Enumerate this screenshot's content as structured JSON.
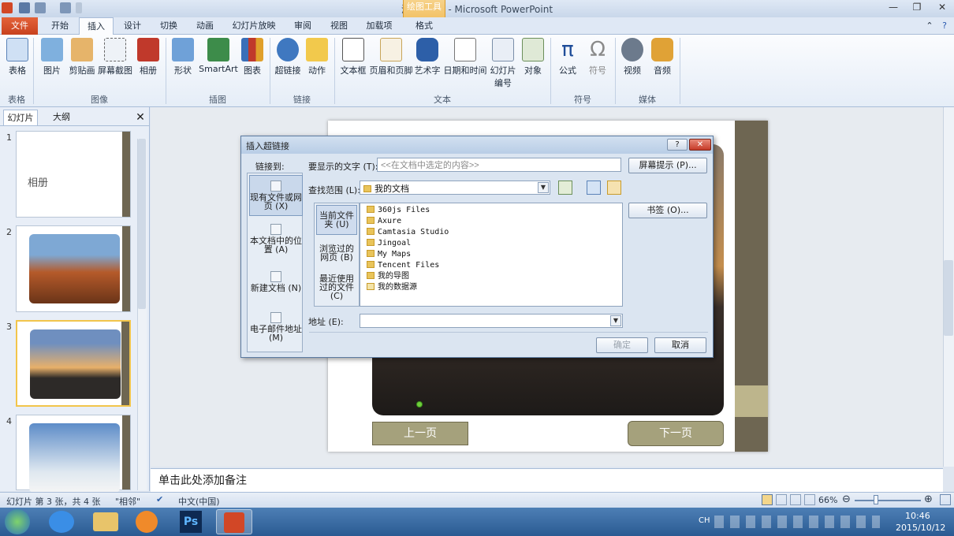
{
  "window": {
    "title": "演示文稿2 - Microsoft PowerPoint",
    "context_tab_group": "绘图工具"
  },
  "tabs": [
    "文件",
    "开始",
    "插入",
    "设计",
    "切换",
    "动画",
    "幻灯片放映",
    "审阅",
    "视图",
    "加载项",
    "格式"
  ],
  "ribbon": {
    "buttons": [
      "表格",
      "图片",
      "剪贴画",
      "屏幕截图",
      "相册",
      "形状",
      "SmartArt",
      "图表",
      "超链接",
      "动作",
      "文本框",
      "页眉和页脚",
      "艺术字",
      "日期和时间",
      "幻灯片编号",
      "对象",
      "公式",
      "符号",
      "视频",
      "音频"
    ],
    "groups": [
      "表格",
      "图像",
      "插图",
      "链接",
      "文本",
      "符号",
      "媒体"
    ]
  },
  "left_panel": {
    "tabs": [
      "幻灯片",
      "大纲"
    ],
    "slide_numbers": [
      "1",
      "2",
      "3",
      "4"
    ],
    "slide1_title": "相册"
  },
  "slide": {
    "prev_button": "上一页",
    "next_button": "下一页"
  },
  "notes_placeholder": "单击此处添加备注",
  "status": {
    "slide_info": "幻灯片 第 3 张，共 4 张",
    "theme": "\"相邻\"",
    "language": "中文(中国)",
    "zoom": "66%"
  },
  "taskbar": {
    "lang": "CH",
    "time": "10:46",
    "date": "2015/10/12"
  },
  "dialog": {
    "title": "插入超链接",
    "link_to_label": "链接到:",
    "display_text_label": "要显示的文字 (T):",
    "display_text_value": "<<在文档中选定的内容>>",
    "screentip_button": "屏幕提示 (P)...",
    "look_in_label": "查找范围 (L):",
    "look_in_value": "我的文档",
    "bookmark_button": "书签 (O)...",
    "nav_items": [
      "现有文件或网页 (X)",
      "本文档中的位置 (A)",
      "新建文档 (N)",
      "电子邮件地址 (M)"
    ],
    "sub_nav_items": [
      "当前文件夹 (U)",
      "浏览过的网页 (B)",
      "最近使用过的文件 (C)"
    ],
    "files": [
      "360js Files",
      "Axure",
      "Camtasia Studio",
      "Jingoal",
      "My Maps",
      "Tencent Files",
      "我的导图",
      "我的数据源"
    ],
    "address_label": "地址 (E):",
    "ok_button": "确定",
    "cancel_button": "取消"
  }
}
